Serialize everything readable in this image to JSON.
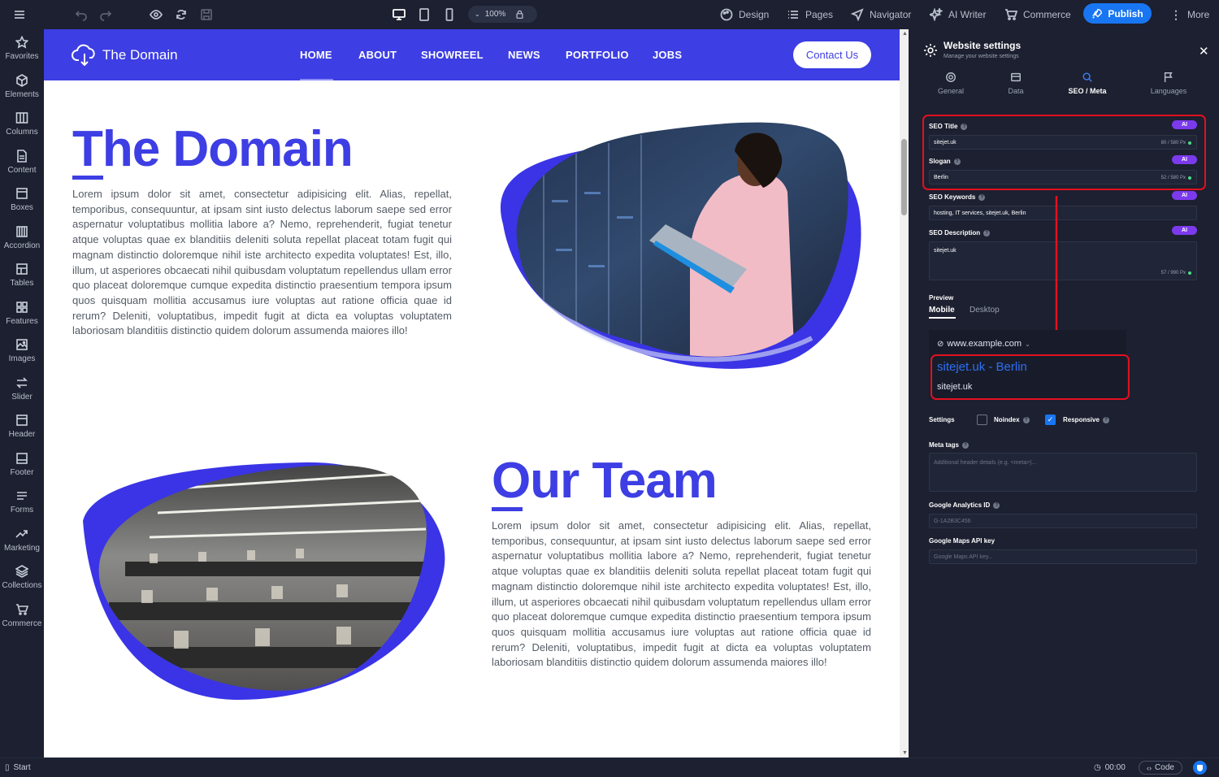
{
  "toolbar": {
    "zoom": "100%",
    "design": "Design",
    "pages": "Pages",
    "navigator": "Navigator",
    "ai_writer": "AI Writer",
    "commerce": "Commerce",
    "publish": "Publish",
    "more": "More"
  },
  "sidebar": {
    "items": [
      {
        "label": "Favorites"
      },
      {
        "label": "Elements"
      },
      {
        "label": "Columns"
      },
      {
        "label": "Content"
      },
      {
        "label": "Boxes"
      },
      {
        "label": "Accordion"
      },
      {
        "label": "Tables"
      },
      {
        "label": "Features"
      },
      {
        "label": "Images"
      },
      {
        "label": "Slider"
      },
      {
        "label": "Header"
      },
      {
        "label": "Footer"
      },
      {
        "label": "Forms"
      },
      {
        "label": "Marketing"
      },
      {
        "label": "Collections"
      },
      {
        "label": "Commerce"
      }
    ]
  },
  "site": {
    "logo": "The Domain",
    "nav": [
      "HOME",
      "ABOUT",
      "SHOWREEL",
      "NEWS",
      "PORTFOLIO",
      "JOBS"
    ],
    "contact": "Contact Us",
    "heading1": "The Domain",
    "heading2": "Our Team",
    "lorem": "Lorem ipsum dolor sit amet, consectetur adipisicing elit. Alias, repellat, temporibus, consequuntur, at ipsam sint iusto delectus laborum saepe sed error aspernatur voluptatibus mollitia labore a? Nemo, reprehenderit, fugiat tenetur atque voluptas quae ex blanditiis deleniti soluta repellat placeat totam fugit qui magnam distinctio doloremque nihil iste architecto expedita voluptates! Est, illo, illum, ut asperiores obcaecati nihil quibusdam voluptatum repellendus ullam error quo placeat doloremque cumque expedita distinctio praesentium tempora ipsum quos quisquam mollitia accusamus iure voluptas aut ratione officia quae id rerum? Deleniti, voluptatibus, impedit fugit at dicta ea voluptas voluptatem laboriosam blanditiis distinctio quidem dolorum assumenda maiores illo!"
  },
  "panel": {
    "title": "Website settings",
    "subtitle": "Manage your website settings",
    "tabs": [
      "General",
      "Data",
      "SEO / Meta",
      "Languages"
    ],
    "ai": "AI",
    "seo_title": {
      "label": "SEO Title",
      "value": "sitejet.uk",
      "count": "80 / 580 Px"
    },
    "slogan": {
      "label": "Slogan",
      "value": "Berlin",
      "count": "52 / 580 Px"
    },
    "keywords": {
      "label": "SEO Keywords",
      "value": "hosting, IT services, sitejet.uk, Berlin"
    },
    "description": {
      "label": "SEO Description",
      "value": "sitejet.uk",
      "count": "57 / 990 Px"
    },
    "preview": {
      "label": "Preview",
      "tabs": [
        "Mobile",
        "Desktop"
      ],
      "url": "www.example.com",
      "title": "sitejet.uk - Berlin",
      "desc": "sitejet.uk"
    },
    "settings": {
      "label": "Settings",
      "noindex": "Noindex",
      "responsive": "Responsive"
    },
    "meta": {
      "label": "Meta tags",
      "placeholder": "Additional header details (e.g. <meta>)..."
    },
    "ga": {
      "label": "Google Analytics ID",
      "placeholder": "G-1A2B3C456"
    },
    "maps": {
      "label": "Google Maps API key",
      "placeholder": "Google Maps API key..."
    }
  },
  "bottom": {
    "start": "Start",
    "time": "00:00",
    "code": "Code"
  }
}
